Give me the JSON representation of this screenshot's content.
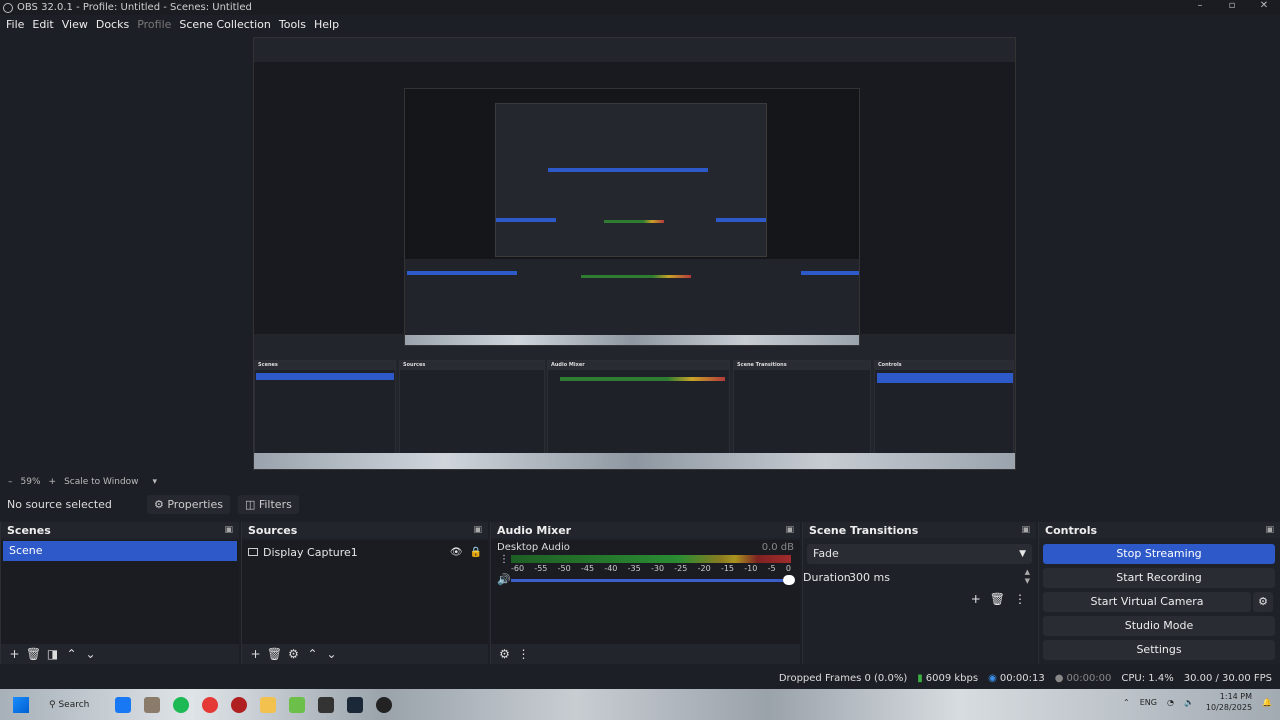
{
  "window": {
    "title": "OBS 32.0.1 - Profile: Untitled - Scenes: Untitled",
    "controls": [
      "–",
      "▫",
      "✕"
    ]
  },
  "menu": [
    {
      "label": "File",
      "enabled": true
    },
    {
      "label": "Edit",
      "enabled": true
    },
    {
      "label": "View",
      "enabled": true
    },
    {
      "label": "Docks",
      "enabled": true
    },
    {
      "label": "Profile",
      "enabled": false
    },
    {
      "label": "Scene Collection",
      "enabled": true
    },
    {
      "label": "Tools",
      "enabled": true
    },
    {
      "label": "Help",
      "enabled": true
    }
  ],
  "zoom": {
    "minus": "–",
    "level": "59%",
    "plus": "+",
    "mode": "Scale to Window"
  },
  "source_toolbar": {
    "no_source": "No source selected",
    "properties": "Properties",
    "filters": "Filters"
  },
  "scenes": {
    "title": "Scenes",
    "items": [
      "Scene"
    ],
    "footer": [
      "+",
      "🗑",
      "◨",
      "⌃",
      "⌄"
    ]
  },
  "sources": {
    "title": "Sources",
    "items": [
      {
        "label": "Display Capture1"
      }
    ],
    "footer": [
      "+",
      "🗑",
      "⚙",
      "⌃",
      "⌄"
    ]
  },
  "audio_mixer": {
    "title": "Audio Mixer",
    "channel": "Desktop Audio",
    "db": "0.0 dB",
    "ticks": [
      "-60",
      "-55",
      "-50",
      "-45",
      "-40",
      "-35",
      "-30",
      "-25",
      "-20",
      "-15",
      "-10",
      "-5",
      "0"
    ],
    "volume": 1.0,
    "footer": [
      "⚙",
      "⋮"
    ]
  },
  "transitions": {
    "title": "Scene Transitions",
    "selected": "Fade",
    "duration_label": "Duration",
    "duration_value": "300 ms",
    "tools": [
      "+",
      "🗑",
      "⋮"
    ]
  },
  "controls": {
    "title": "Controls",
    "buttons": [
      "Stop Streaming",
      "Start Recording",
      "Start Virtual Camera",
      "Studio Mode",
      "Settings"
    ]
  },
  "status": {
    "dropped": "Dropped Frames 0 (0.0%)",
    "bitrate": "6009 kbps",
    "stream_time": "00:00:13",
    "rec_time": "00:00:00",
    "cpu": "CPU: 1.4%",
    "fps": "30.00 / 30.00 FPS"
  },
  "taskbar": {
    "search": "Search",
    "lang": "ENG",
    "time": "1:14 PM",
    "date": "10/28/2025",
    "app_colors": [
      "#1877f2",
      "#8a7b6b",
      "#1db954",
      "#e53935",
      "#e8e8e8",
      "#f2c14e",
      "#6cc04a",
      "#333333",
      "#1b2838",
      "#222222"
    ]
  },
  "colors": {
    "accent": "#2d59c9"
  }
}
